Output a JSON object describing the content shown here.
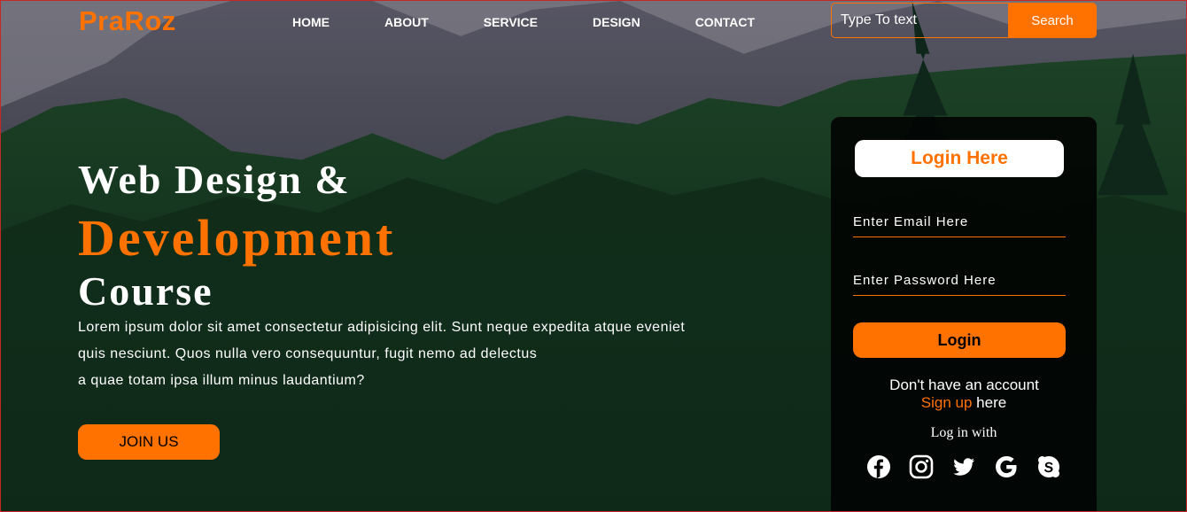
{
  "brand": {
    "logo": "PraRoz",
    "accent_color": "#ff7200"
  },
  "nav": {
    "items": [
      {
        "label": "HOME"
      },
      {
        "label": "ABOUT"
      },
      {
        "label": "SERVICE"
      },
      {
        "label": "DESIGN"
      },
      {
        "label": "CONTACT"
      }
    ]
  },
  "search": {
    "placeholder": "Type To text",
    "button_label": "Search"
  },
  "hero": {
    "title_line1": "Web Design &",
    "title_line2": "Development",
    "title_line3": "Course",
    "paragraph_line1": "Lorem ipsum dolor sit amet consectetur adipisicing elit. Sunt neque expedita atque eveniet",
    "paragraph_line2": "quis nesciunt. Quos nulla vero consequuntur, fugit nemo ad delectus",
    "paragraph_line3": "a quae totam ipsa illum minus laudantium?",
    "cta_label": "JOIN US"
  },
  "login": {
    "title": "Login Here",
    "email_placeholder": "Enter Email Here",
    "password_placeholder": "Enter Password Here",
    "button_label": "Login",
    "no_account_text": "Don't have an account",
    "signup_link": "Sign up",
    "signup_suffix": " here",
    "log_in_with": "Log in with",
    "social_icons": [
      "facebook-icon",
      "instagram-icon",
      "twitter-icon",
      "google-icon",
      "skype-icon"
    ]
  }
}
